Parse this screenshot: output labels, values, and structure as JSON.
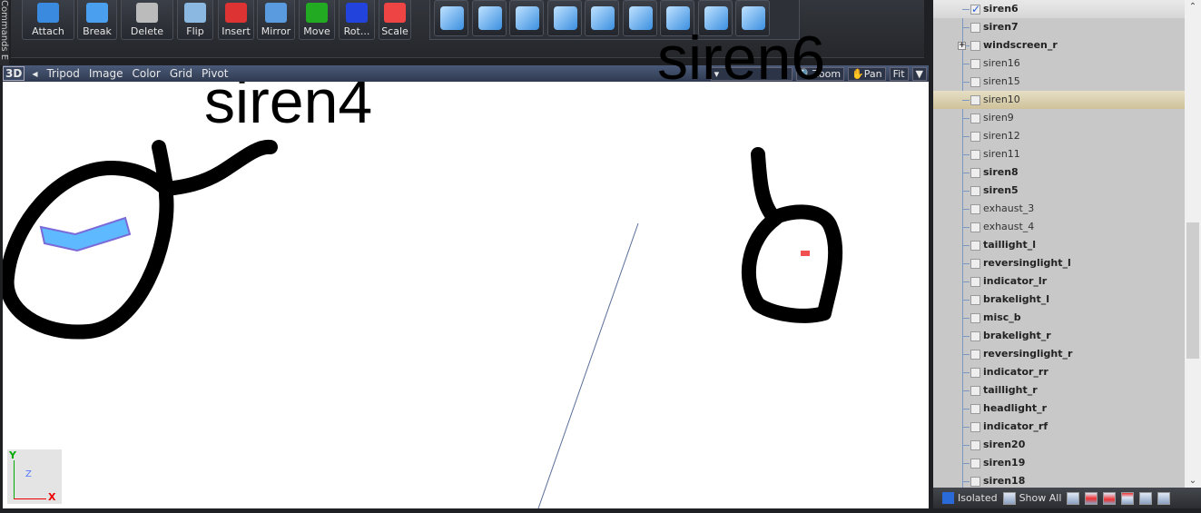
{
  "side_tab": "Commands E",
  "toolbar": {
    "buttons": [
      "Attach",
      "Break",
      "Delete",
      "Flip",
      "Insert",
      "Mirror",
      "Move",
      "Rot...",
      "Scale"
    ],
    "icon_buttons": [
      "cube-icon",
      "brush-icon",
      "split-icon",
      "extrude-icon",
      "push-icon",
      "cut-icon",
      "triangulate-icon",
      "bevel-icon",
      "weld-icon"
    ]
  },
  "viewport_bar": {
    "mode": "3D",
    "menu": [
      "Tripod",
      "Image",
      "Color",
      "Grid",
      "Pivot"
    ],
    "zoom": "Zoom",
    "pan": "Pan",
    "fit": "Fit"
  },
  "annotations": {
    "left": "siren4",
    "right": "siren6"
  },
  "axes": {
    "y": "Y",
    "x": "X",
    "z": "Z"
  },
  "tree": [
    {
      "label": "siren6",
      "bold": true,
      "checked": true
    },
    {
      "label": "siren7",
      "bold": true
    },
    {
      "label": "windscreen_r",
      "bold": true,
      "expandable": true
    },
    {
      "label": "siren16"
    },
    {
      "label": "siren15"
    },
    {
      "label": "siren10",
      "selected": true
    },
    {
      "label": "siren9"
    },
    {
      "label": "siren12"
    },
    {
      "label": "siren11"
    },
    {
      "label": "siren8",
      "bold": true
    },
    {
      "label": "siren5",
      "bold": true
    },
    {
      "label": "exhaust_3"
    },
    {
      "label": "exhaust_4"
    },
    {
      "label": "taillight_l",
      "bold": true
    },
    {
      "label": "reversinglight_l",
      "bold": true
    },
    {
      "label": "indicator_lr",
      "bold": true
    },
    {
      "label": "brakelight_l",
      "bold": true
    },
    {
      "label": "misc_b",
      "bold": true
    },
    {
      "label": "brakelight_r",
      "bold": true
    },
    {
      "label": "reversinglight_r",
      "bold": true
    },
    {
      "label": "indicator_rr",
      "bold": true
    },
    {
      "label": "taillight_r",
      "bold": true
    },
    {
      "label": "headlight_r",
      "bold": true
    },
    {
      "label": "indicator_rf",
      "bold": true
    },
    {
      "label": "siren20",
      "bold": true
    },
    {
      "label": "siren19",
      "bold": true
    },
    {
      "label": "siren18",
      "bold": true
    }
  ],
  "bottom": {
    "isolated": "Isolated",
    "show_all": "Show All"
  }
}
